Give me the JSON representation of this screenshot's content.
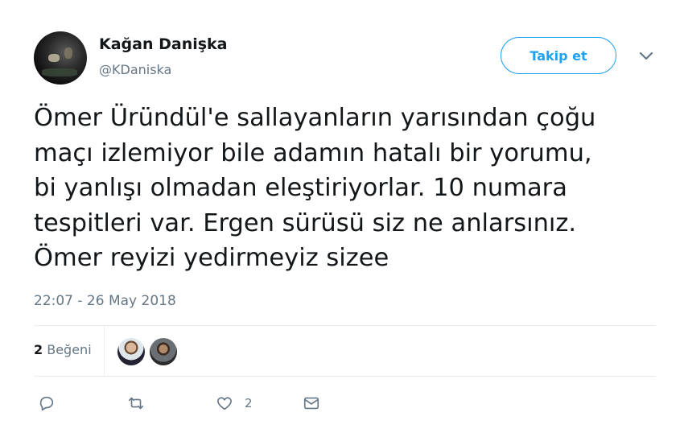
{
  "author": {
    "name": "Kağan Danişka",
    "handle": "@KDaniska"
  },
  "follow_label": "Takip et",
  "tweet": {
    "lines": [
      "Ömer Üründül'e sallayanların yarısından çoğu",
      "maçı izlemiyor bile adamın hatalı bir yorumu,",
      "bi yanlışı olmadan eleştiriyorlar. 10 numara",
      "tespitleri var. Ergen sürüsü siz ne anlarsınız.",
      "Ömer reyizi yedirmeyiz sizee"
    ],
    "timestamp": "22:07 - 26 May 2018"
  },
  "likes": {
    "count": "2",
    "label": "Beğeni"
  },
  "actions": {
    "like_count": "2"
  },
  "icons": [
    "avatar",
    "chevron-down-icon",
    "reply-icon",
    "retweet-icon",
    "heart-icon",
    "message-icon"
  ],
  "colors": {
    "accent": "#1da1f2",
    "text": "#14171a",
    "secondary": "#657786",
    "divider": "#e6ecf0"
  }
}
